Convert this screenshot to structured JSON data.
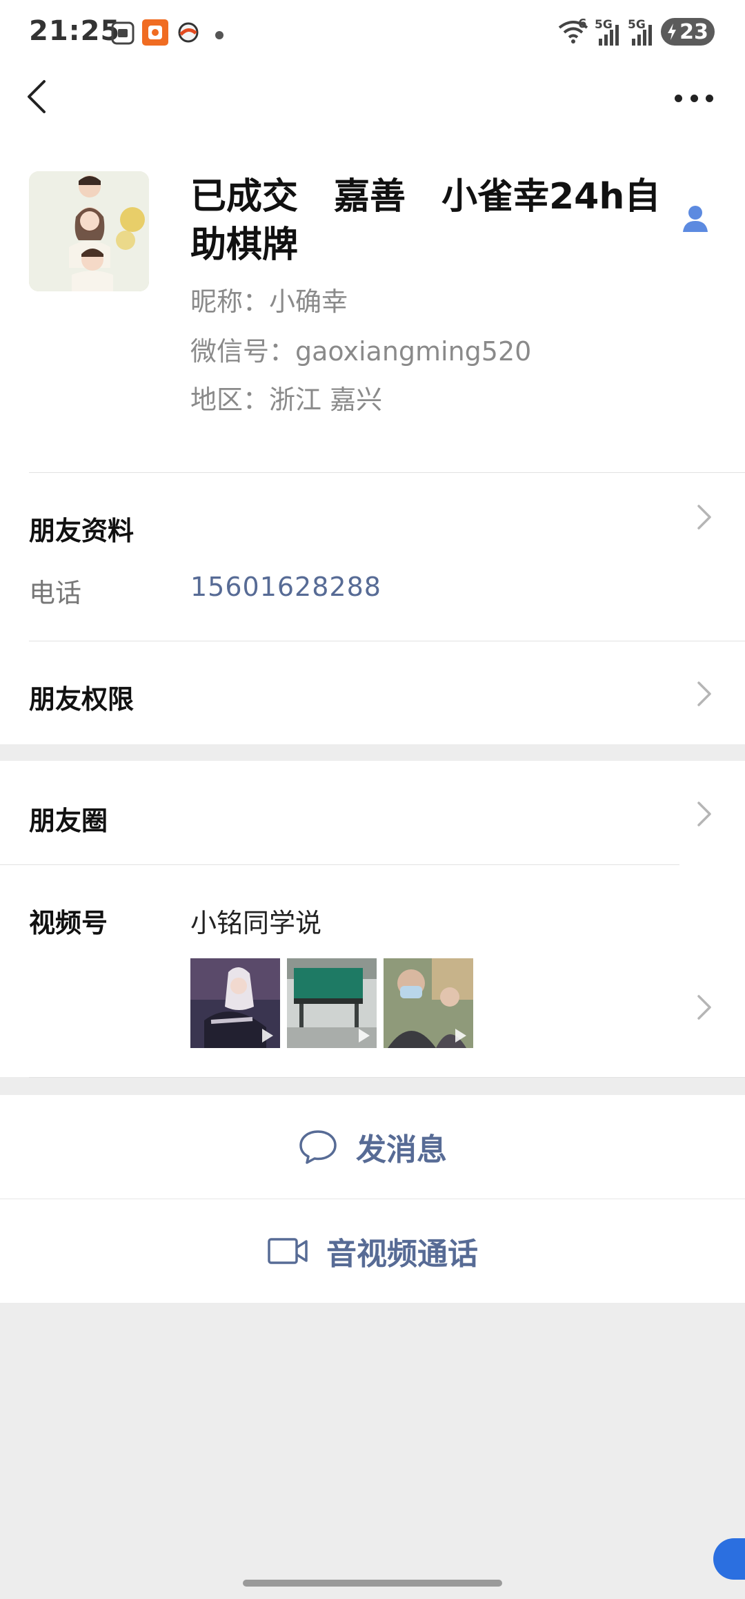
{
  "status_bar": {
    "time": "21:25",
    "network_labels": [
      "5G",
      "5G"
    ],
    "wifi_badge": "6",
    "battery": "23"
  },
  "nav": {
    "back_icon": "chevron-left-icon",
    "more_icon": "more-dots-icon"
  },
  "profile": {
    "name": "已成交　嘉善　小雀幸24h自助棋牌",
    "nickname": "昵称：小确幸",
    "wechat_id": "微信号：gaoxiangming520",
    "region": "地区：浙江 嘉兴"
  },
  "friend_info": {
    "title": "朋友资料",
    "phone_label": "电话",
    "phone_value": "15601628288"
  },
  "permissions": {
    "title": "朋友权限"
  },
  "moments": {
    "title": "朋友圈"
  },
  "channels": {
    "title": "视频号",
    "name": "小铭同学说",
    "thumbnails": [
      "video-thumbnail-1",
      "video-thumbnail-2",
      "video-thumbnail-3"
    ]
  },
  "actions": {
    "message": "发消息",
    "call": "音视频通话"
  },
  "colors": {
    "link": "#576b95",
    "background": "#ededed",
    "accent_blue": "#2b6fe0"
  }
}
